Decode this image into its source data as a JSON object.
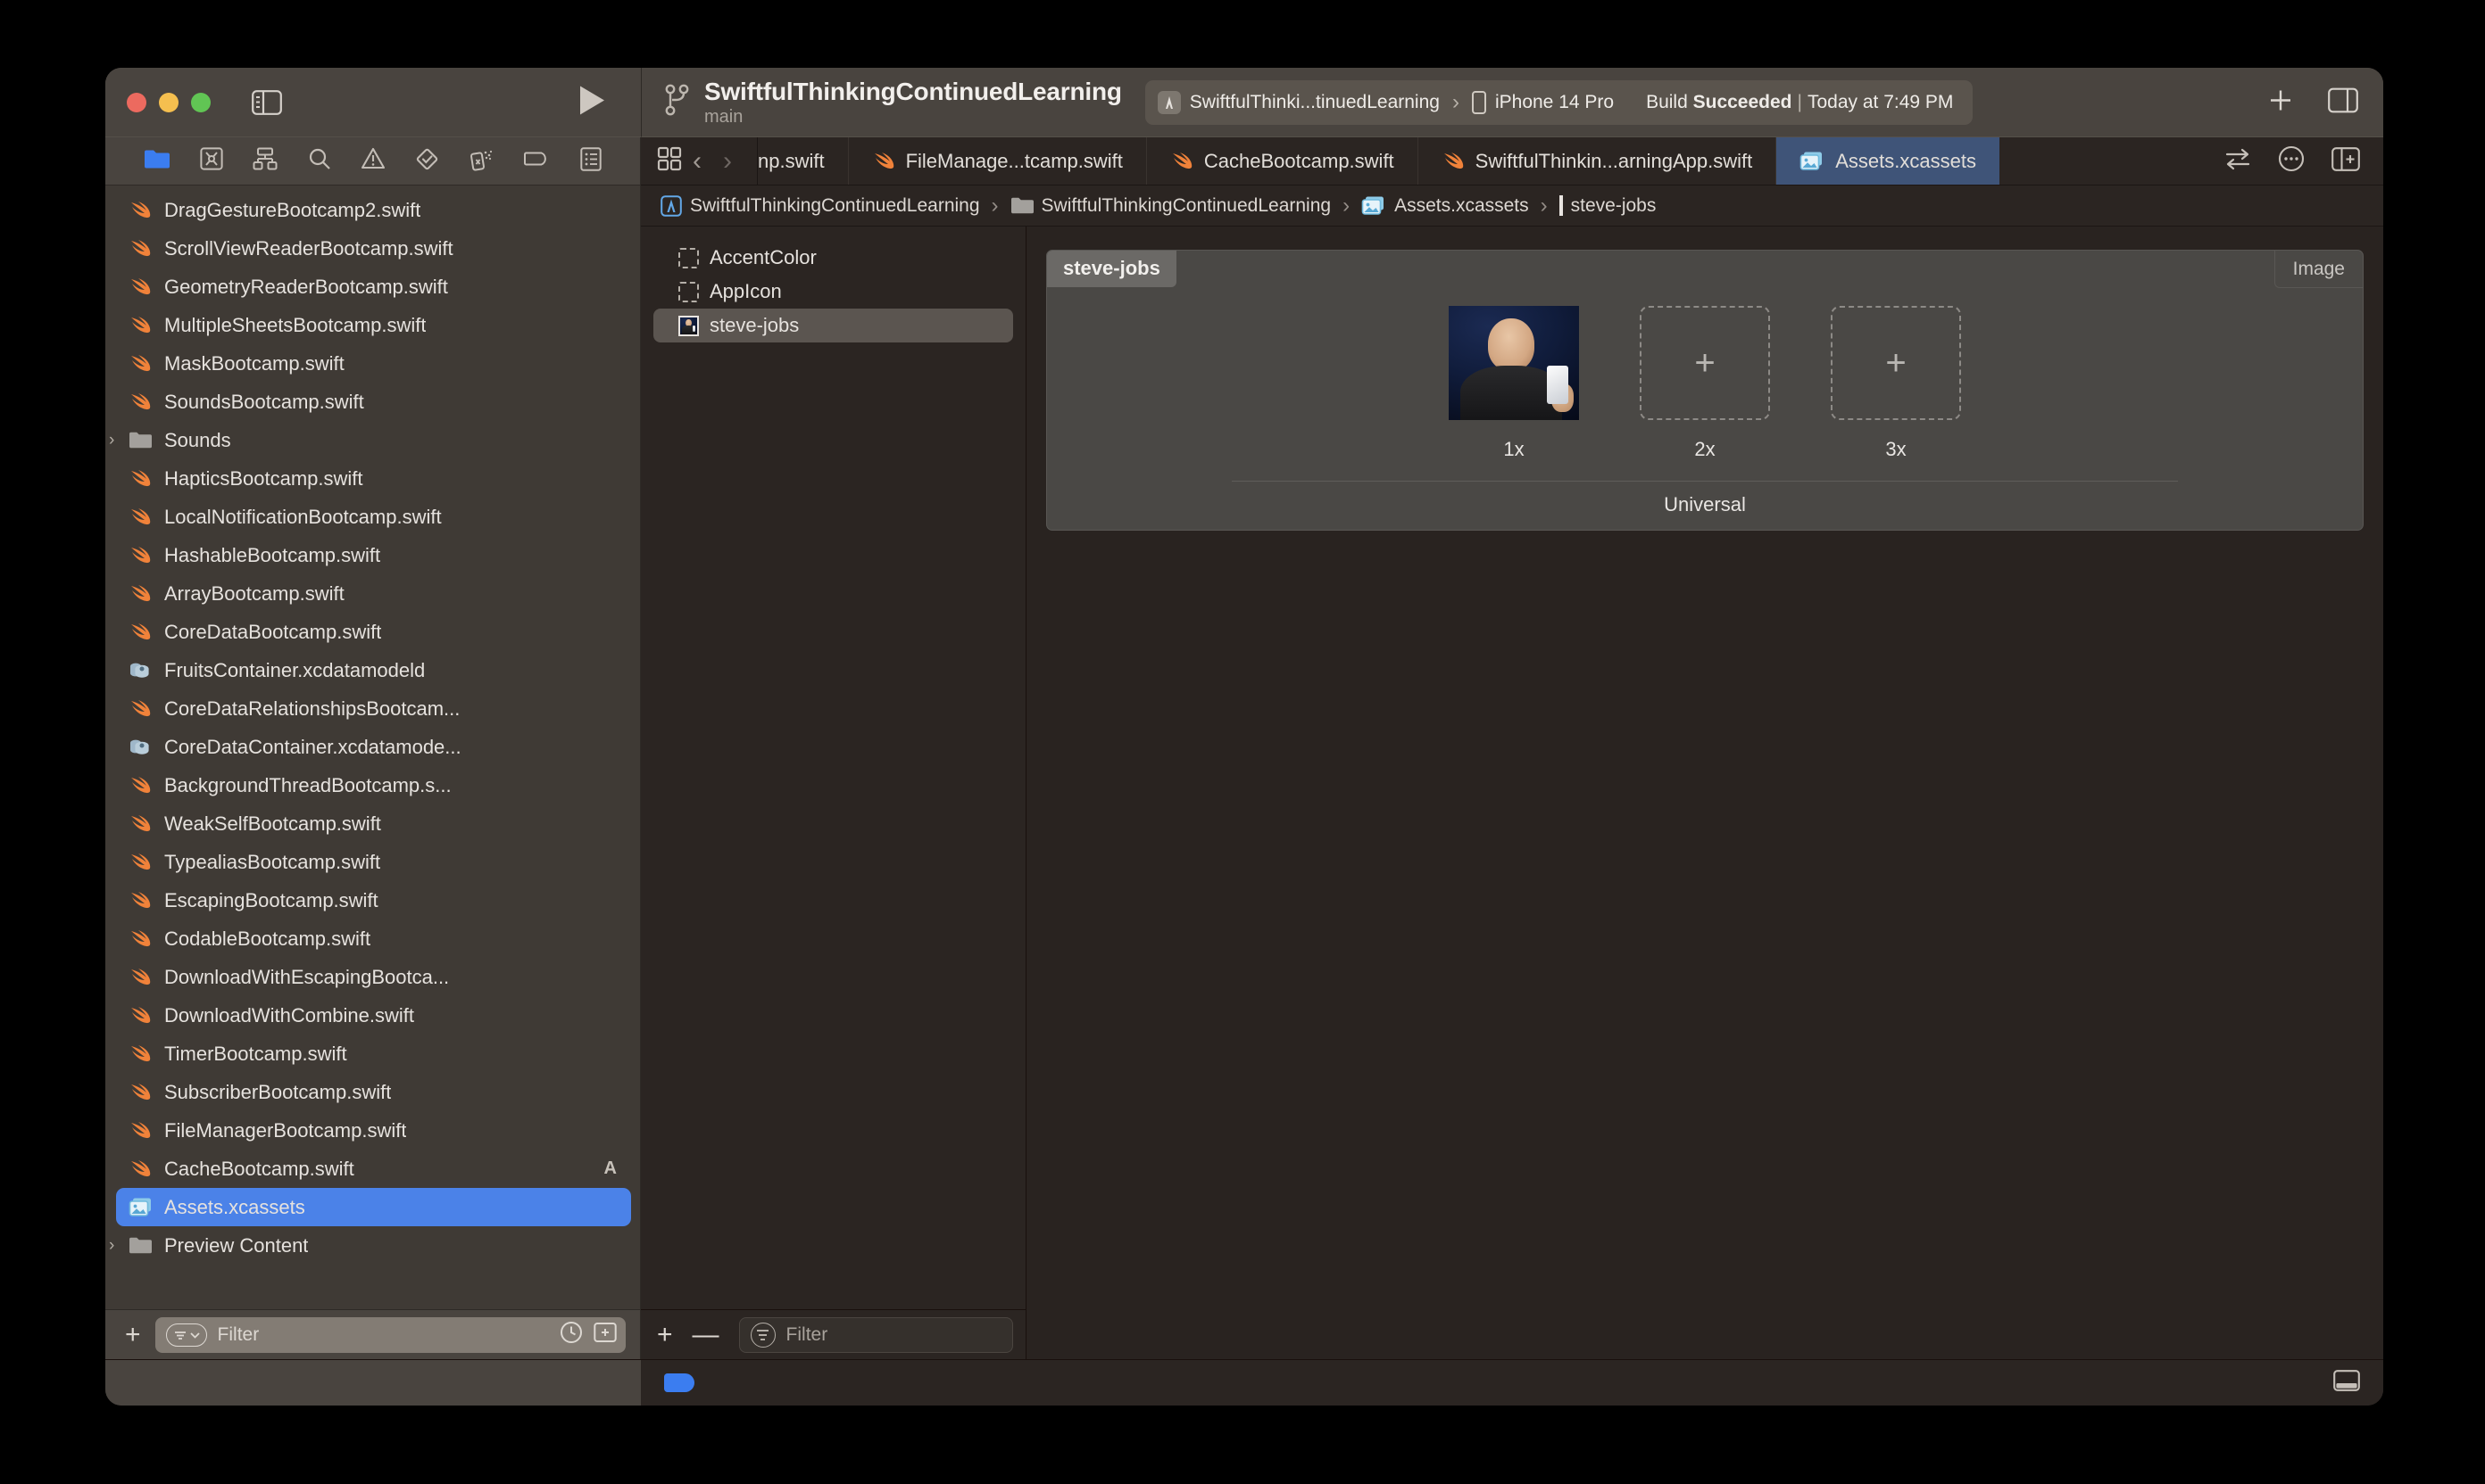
{
  "window": {
    "traffic_lights": [
      "close",
      "minimize",
      "zoom"
    ],
    "colors": {
      "close": "#ec6a5f",
      "minimize": "#f5bf4f",
      "zoom": "#61c554",
      "accent_blue": "#4b82e8",
      "tab_active": "#3f5478"
    }
  },
  "toolbar": {
    "project_title": "SwiftfulThinkingContinuedLearning",
    "branch": "main",
    "scheme": "SwiftfulThinki...tinuedLearning",
    "destination": "iPhone 14 Pro",
    "status_prefix": "Build ",
    "status_result": "Succeeded",
    "status_separator": "|",
    "status_time": "Today at 7:49 PM",
    "add_label": "+",
    "sidebar_toggle_icon": "sidebar-left-icon",
    "run_icon": "play-icon",
    "branch_icon": "source-control-branch-icon",
    "inspector_toggle_icon": "sidebar-right-icon"
  },
  "navigator": {
    "icon_tabs": [
      {
        "name": "project-navigator",
        "icon": "folder-icon",
        "active": true
      },
      {
        "name": "source-control-navigator",
        "icon": "source-control-icon",
        "active": false
      },
      {
        "name": "symbol-navigator",
        "icon": "hierarchy-icon",
        "active": false
      },
      {
        "name": "find-navigator",
        "icon": "search-icon",
        "active": false
      },
      {
        "name": "issue-navigator",
        "icon": "warning-triangle-icon",
        "active": false
      },
      {
        "name": "test-navigator",
        "icon": "diamond-check-icon",
        "active": false
      },
      {
        "name": "debug-navigator",
        "icon": "spray-can-icon",
        "active": false
      },
      {
        "name": "breakpoint-navigator",
        "icon": "tag-icon",
        "active": false
      },
      {
        "name": "report-navigator",
        "icon": "report-list-icon",
        "active": false
      }
    ],
    "files": [
      {
        "label": "DragGestureBootcamp2.swift",
        "icon": "swift-file-icon",
        "indent": 1
      },
      {
        "label": "ScrollViewReaderBootcamp.swift",
        "icon": "swift-file-icon",
        "indent": 1
      },
      {
        "label": "GeometryReaderBootcamp.swift",
        "icon": "swift-file-icon",
        "indent": 1
      },
      {
        "label": "MultipleSheetsBootcamp.swift",
        "icon": "swift-file-icon",
        "indent": 1
      },
      {
        "label": "MaskBootcamp.swift",
        "icon": "swift-file-icon",
        "indent": 1
      },
      {
        "label": "SoundsBootcamp.swift",
        "icon": "swift-file-icon",
        "indent": 1
      },
      {
        "label": "Sounds",
        "icon": "folder-gray-icon",
        "indent": 0,
        "disclosure": "›"
      },
      {
        "label": "HapticsBootcamp.swift",
        "icon": "swift-file-icon",
        "indent": 1
      },
      {
        "label": "LocalNotificationBootcamp.swift",
        "icon": "swift-file-icon",
        "indent": 1
      },
      {
        "label": "HashableBootcamp.swift",
        "icon": "swift-file-icon",
        "indent": 1
      },
      {
        "label": "ArrayBootcamp.swift",
        "icon": "swift-file-icon",
        "indent": 1
      },
      {
        "label": "CoreDataBootcamp.swift",
        "icon": "swift-file-icon",
        "indent": 1
      },
      {
        "label": "FruitsContainer.xcdatamodeld",
        "icon": "xcdatamodel-icon",
        "indent": 1
      },
      {
        "label": "CoreDataRelationshipsBootcam...",
        "icon": "swift-file-icon",
        "indent": 1
      },
      {
        "label": "CoreDataContainer.xcdatamode...",
        "icon": "xcdatamodel-icon",
        "indent": 1
      },
      {
        "label": "BackgroundThreadBootcamp.s...",
        "icon": "swift-file-icon",
        "indent": 1
      },
      {
        "label": "WeakSelfBootcamp.swift",
        "icon": "swift-file-icon",
        "indent": 1
      },
      {
        "label": "TypealiasBootcamp.swift",
        "icon": "swift-file-icon",
        "indent": 1
      },
      {
        "label": "EscapingBootcamp.swift",
        "icon": "swift-file-icon",
        "indent": 1
      },
      {
        "label": "CodableBootcamp.swift",
        "icon": "swift-file-icon",
        "indent": 1
      },
      {
        "label": "DownloadWithEscapingBootca...",
        "icon": "swift-file-icon",
        "indent": 1
      },
      {
        "label": "DownloadWithCombine.swift",
        "icon": "swift-file-icon",
        "indent": 1
      },
      {
        "label": "TimerBootcamp.swift",
        "icon": "swift-file-icon",
        "indent": 1
      },
      {
        "label": "SubscriberBootcamp.swift",
        "icon": "swift-file-icon",
        "indent": 1
      },
      {
        "label": "FileManagerBootcamp.swift",
        "icon": "swift-file-icon",
        "indent": 1
      },
      {
        "label": "CacheBootcamp.swift",
        "icon": "swift-file-icon",
        "indent": 1,
        "badge": "A"
      },
      {
        "label": "Assets.xcassets",
        "icon": "asset-catalog-icon",
        "indent": 1,
        "selected": true
      },
      {
        "label": "Preview Content",
        "icon": "folder-gray-icon",
        "indent": 0,
        "disclosure": "›"
      }
    ],
    "filter": {
      "placeholder": "Filter",
      "value": "",
      "add_label": "+",
      "recent_icon": "clock-icon",
      "scope_icon": "add-rule-icon"
    }
  },
  "editor": {
    "tab_nav": {
      "grid_icon": "tab-overview-icon",
      "back_icon": "chevron-left-icon",
      "forward_icon": "chevron-right-icon"
    },
    "tabs": [
      {
        "label": "np.swift",
        "icon": "swift-file-icon",
        "active": false,
        "clipped": true
      },
      {
        "label": "FileManage...tcamp.swift",
        "icon": "swift-file-icon",
        "active": false
      },
      {
        "label": "CacheBootcamp.swift",
        "icon": "swift-file-icon",
        "active": false
      },
      {
        "label": "SwiftfulThinkin...arningApp.swift",
        "icon": "swift-file-icon",
        "active": false
      },
      {
        "label": "Assets.xcassets",
        "icon": "asset-catalog-icon",
        "active": true
      }
    ],
    "tab_right_controls": [
      {
        "name": "code-review-icon",
        "glyph": "⇄"
      },
      {
        "name": "more-options-icon",
        "glyph": "⋯"
      },
      {
        "name": "add-editor-icon",
        "glyph": "⊞"
      }
    ],
    "breadcrumbs": [
      {
        "label": "SwiftfulThinkingContinuedLearning",
        "icon": "xcode-project-icon"
      },
      {
        "label": "SwiftfulThinkingContinuedLearning",
        "icon": "folder-gray-icon"
      },
      {
        "label": "Assets.xcassets",
        "icon": "asset-catalog-icon"
      },
      {
        "label": "steve-jobs",
        "icon": "image-thumbnail-icon"
      }
    ],
    "breadcrumb_separator": "›"
  },
  "asset_panel": {
    "items": [
      {
        "label": "AccentColor",
        "icon": "color-set-placeholder-icon",
        "selected": false
      },
      {
        "label": "AppIcon",
        "icon": "app-icon-placeholder-icon",
        "selected": false
      },
      {
        "label": "steve-jobs",
        "icon": "image-thumbnail-icon",
        "selected": true
      }
    ],
    "filter": {
      "placeholder": "Filter",
      "value": "",
      "add_label": "+",
      "remove_label": "—",
      "filter_icon": "filter-lines-icon"
    }
  },
  "asset_detail": {
    "name": "steve-jobs",
    "kind": "Image",
    "device_class": "Universal",
    "slots": [
      {
        "scale": "1x",
        "filled": true,
        "image_alt": "steve-jobs-photo"
      },
      {
        "scale": "2x",
        "filled": false,
        "add_glyph": "+"
      },
      {
        "scale": "3x",
        "filled": false,
        "add_glyph": "+"
      }
    ]
  },
  "status_bar": {
    "tag_color": "#3b7df0",
    "right_icon": "show-console-icon"
  }
}
